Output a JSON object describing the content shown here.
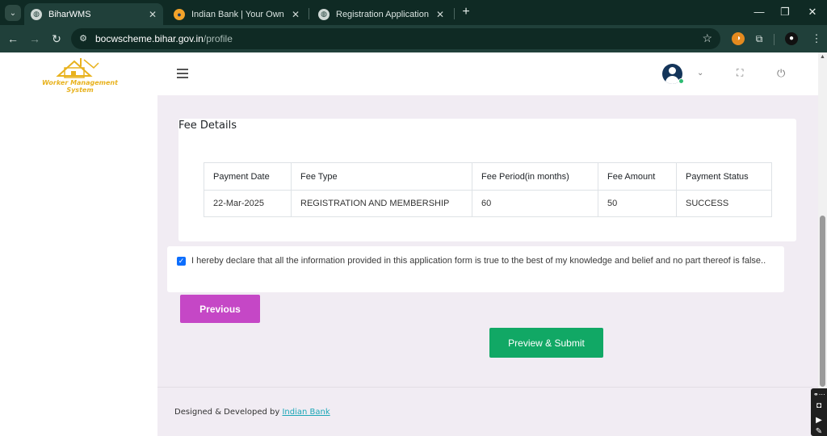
{
  "browser": {
    "tabs": [
      {
        "label": "BiharWMS",
        "active": true
      },
      {
        "label": "Indian Bank | Your Own Bank :: I",
        "active": false
      },
      {
        "label": "Registration Application Registr",
        "active": false
      }
    ],
    "url_host": "bocwscheme.bihar.gov.in",
    "url_path": "/profile"
  },
  "sidebar": {
    "logo_line1": "Worker Management",
    "logo_line2": "System"
  },
  "fee_details": {
    "title": "Fee Details",
    "columns": [
      "Payment Date",
      "Fee Type",
      "Fee Period(in months)",
      "Fee Amount",
      "Payment Status"
    ],
    "rows": [
      [
        "22-Mar-2025",
        "REGISTRATION AND MEMBERSHIP",
        "60",
        "50",
        "SUCCESS"
      ]
    ]
  },
  "declaration": {
    "checked": true,
    "text": "I hereby declare that all the information provided in this application form is true to the best of my knowledge and belief and no part thereof is false.."
  },
  "buttons": {
    "previous": "Previous",
    "preview_submit": "Preview & Submit"
  },
  "footer": {
    "prefix": "Designed & Developed by",
    "link": "Indian Bank"
  },
  "colors": {
    "previous_button": "#c547c6",
    "submit_button": "#11a865",
    "page_background": "#f1ecf3",
    "browser_frame": "#20403a"
  }
}
